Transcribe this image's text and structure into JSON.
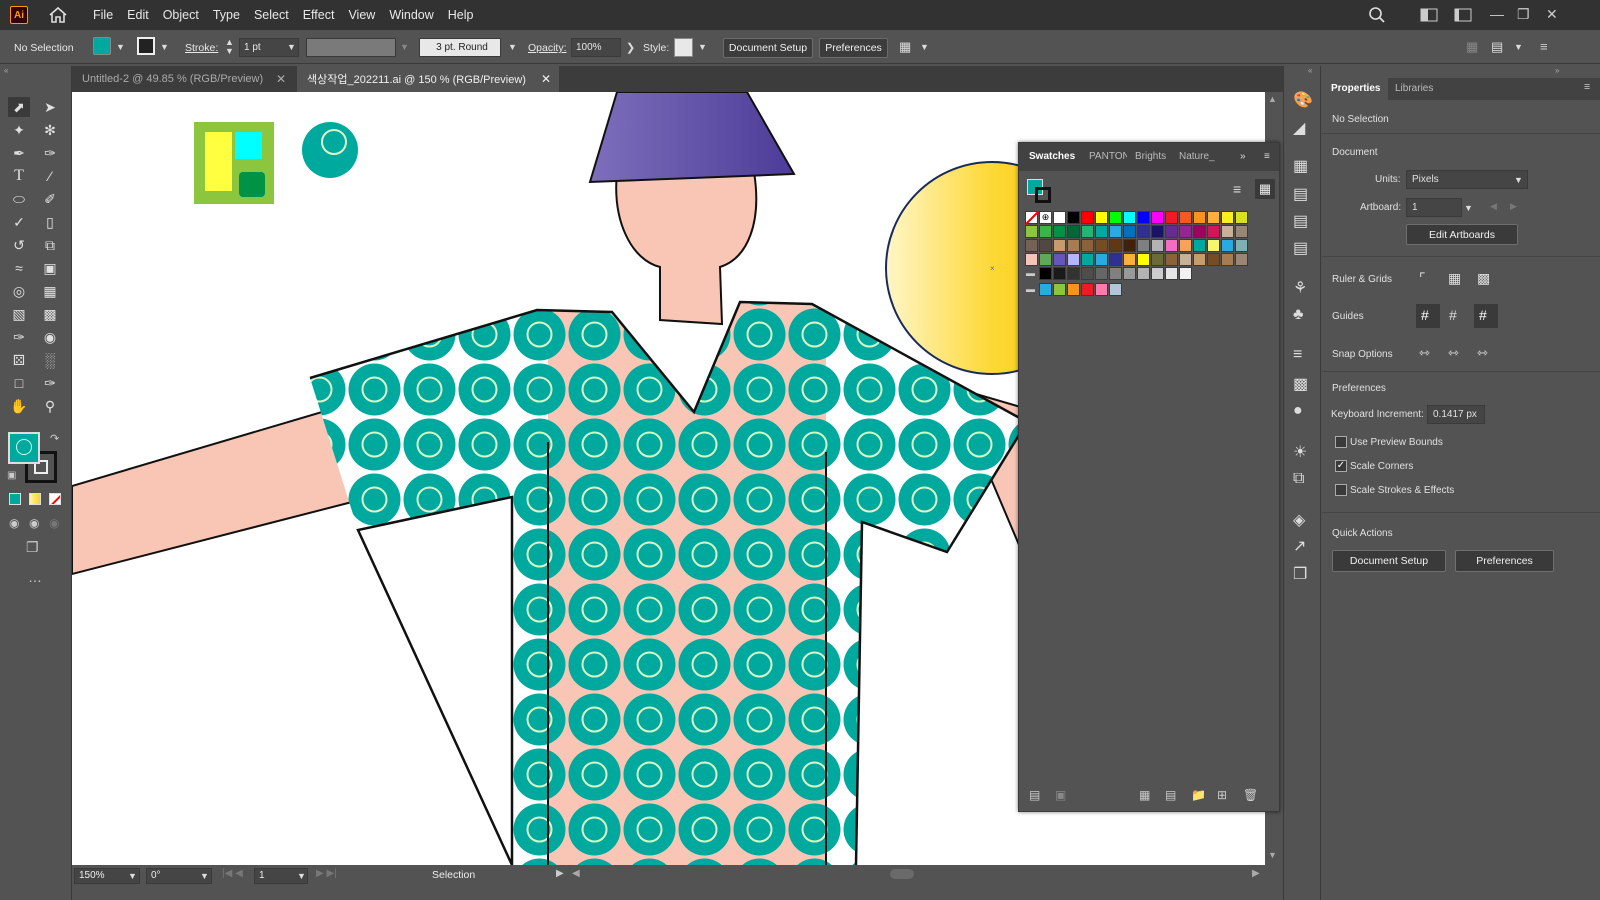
{
  "app": {
    "logo": "Ai"
  },
  "menu": [
    "File",
    "Edit",
    "Object",
    "Type",
    "Select",
    "Effect",
    "View",
    "Window",
    "Help"
  ],
  "control_bar": {
    "selection": "No Selection",
    "stroke_label": "Stroke:",
    "stroke_value": "1 pt",
    "brush": "3 pt. Round",
    "opacity_label": "Opacity:",
    "opacity_value": "100%",
    "style_label": "Style:",
    "document_setup": "Document Setup",
    "preferences": "Preferences"
  },
  "tabs": [
    {
      "label": "Untitled-2 @ 49.85 % (RGB/Preview)",
      "active": false
    },
    {
      "label": "색상작업_202211.ai @ 150 % (RGB/Preview)",
      "active": true
    }
  ],
  "status": {
    "zoom": "150%",
    "rotation": "0°",
    "artboard": "1",
    "tool": "Selection"
  },
  "swatches_panel": {
    "tabs": [
      "Swatches",
      "PANTONE",
      "Brights",
      "Nature_"
    ],
    "rows": [
      [
        "none",
        "reg",
        "#ffffff",
        "#000000",
        "#ff0000",
        "#ffff00",
        "#00ff00",
        "#00ffff",
        "#0000ff",
        "#ff00ff",
        "#ed1c24",
        "#f15a24",
        "#f7931e",
        "#fbb03b",
        "#fcee21",
        "#d9e021"
      ],
      [
        "#8cc63f",
        "#39b54a",
        "#009245",
        "#006837",
        "#22b573",
        "#00a99d",
        "#29abe2",
        "#0071bc",
        "#2e3192",
        "#1b1464",
        "#662d91",
        "#93278f",
        "#9e005d",
        "#d4145a",
        "#c7b299",
        "#998675"
      ],
      [
        "#736357",
        "#534741",
        "#c69c6d",
        "#a67c52",
        "#8c6239",
        "#754c24",
        "#603813",
        "#42210b",
        "#808080",
        "#b3b3b3",
        "#f26ec0",
        "#f7a15a",
        "#00a99d",
        "#f5f56e",
        "#29abe2",
        "#7fb1b2"
      ],
      [
        "#f4c4b8",
        "#5fa85a",
        "#6655bb",
        "#b3b3ff",
        "#00a99d",
        "#29abe2",
        "#2e3192",
        "#fbb03b",
        "#ffff00",
        "#6b6b33",
        "#8c6239",
        "#c7b299",
        "#c69c6d",
        "#754c24",
        "#a67c52",
        "#998675"
      ]
    ],
    "grays": [
      "#000000",
      "#1a1a1a",
      "#333333",
      "#4d4d4d",
      "#666666",
      "#808080",
      "#999999",
      "#b3b3b3",
      "#cccccc",
      "#e6e6e6",
      "#f2f2f2"
    ],
    "brights": [
      "#29abe2",
      "#8cc63f",
      "#f7931e",
      "#ed1c24",
      "#ff7bac",
      "#b3c6d8"
    ]
  },
  "properties": {
    "tabs": [
      "Properties",
      "Libraries"
    ],
    "selection": "No Selection",
    "document": "Document",
    "units_label": "Units:",
    "units_value": "Pixels",
    "artboard_label": "Artboard:",
    "artboard_value": "1",
    "edit_artboards": "Edit Artboards",
    "ruler_grids": "Ruler & Grids",
    "guides": "Guides",
    "snap_options": "Snap Options",
    "preferences": "Preferences",
    "keyboard_increment_label": "Keyboard Increment:",
    "keyboard_increment_value": "0.1417 px",
    "use_preview_bounds": "Use Preview Bounds",
    "scale_corners": "Scale Corners",
    "scale_strokes": "Scale Strokes & Effects",
    "quick_actions": "Quick Actions",
    "document_setup": "Document Setup",
    "preferences_btn": "Preferences"
  },
  "colors": {
    "teal": "#00a99d",
    "skin": "#f9c6b6",
    "purple": "#5b4a9e",
    "yellow": "#fbd51c",
    "ui_bg": "#535353"
  }
}
